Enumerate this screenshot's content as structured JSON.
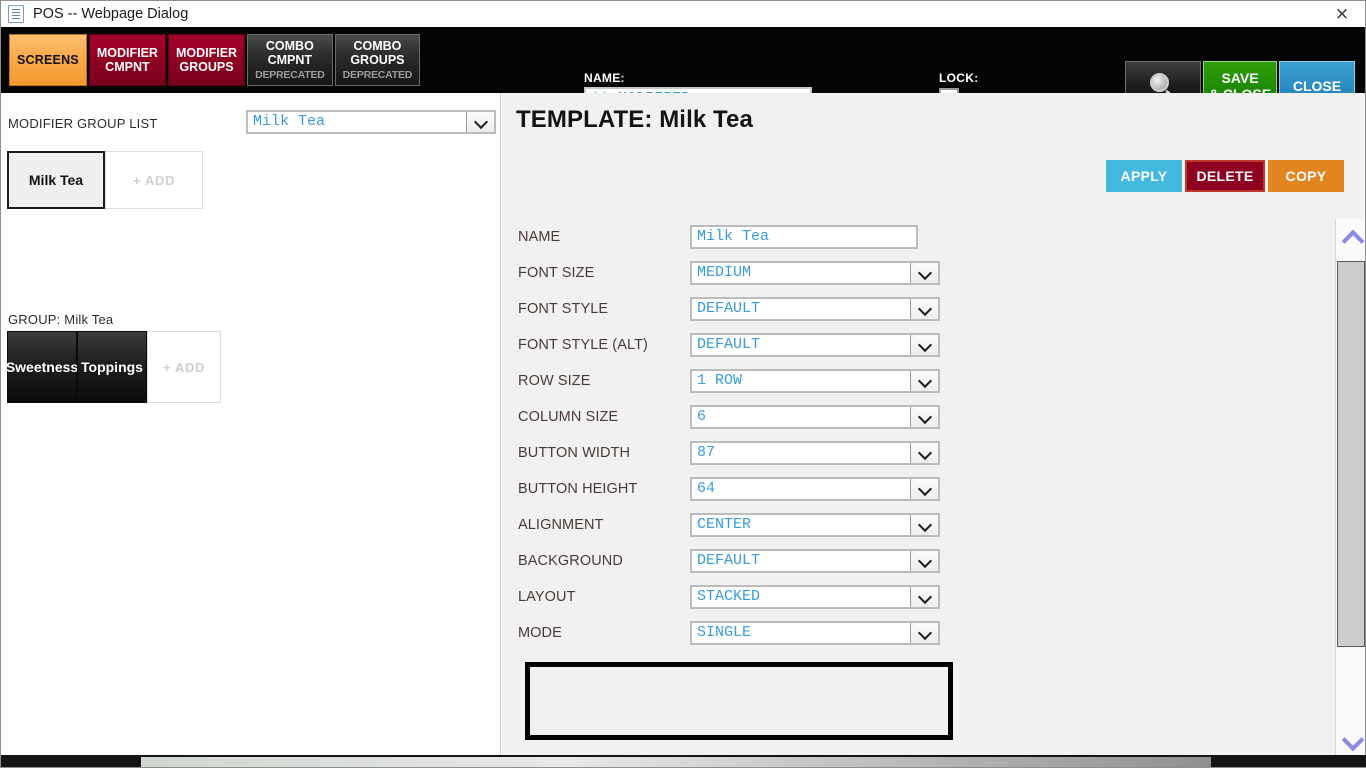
{
  "window": {
    "title": "POS -- Webpage Dialog",
    "doc_icon": "document-icon",
    "close_icon": "×"
  },
  "toolbar": {
    "tabs": [
      {
        "label": "SCREENS",
        "sub": "",
        "style": "screens"
      },
      {
        "label_line1": "MODIFIER",
        "label_line2": "CMPNT",
        "sub": "",
        "style": "crimson"
      },
      {
        "label_line1": "MODIFIER",
        "label_line2": "GROUPS",
        "sub": "",
        "style": "crimson"
      },
      {
        "label_line1": "COMBO",
        "label_line2": "CMPNT",
        "sub": "DEPRECATED",
        "style": "dark"
      },
      {
        "label_line1": "COMBO",
        "label_line2": "GROUPS",
        "sub": "DEPRECATED",
        "style": "dark"
      }
    ],
    "name_caption": "NAME:",
    "name_value": "!! MODIFIER",
    "name_placeholder": "",
    "lock_caption": "LOCK:",
    "lock_checked": false,
    "search_icon": "magnifier-icon",
    "save_label_line1": "SAVE",
    "save_label_line2": "& CLOSE",
    "close_label": "CLOSE",
    "colors": {
      "screens": "#f9a847",
      "crimson": "#8e0021",
      "save": "#1f8a05",
      "close": "#2b8cc2",
      "accent_value": "#3a9bdc"
    }
  },
  "sidebar": {
    "list_label": "MODIFIER GROUP LIST",
    "group_dropdown_value": "Milk Tea",
    "group_buttons": [
      {
        "label": "Milk Tea",
        "state": "selected"
      },
      {
        "label": "+ ADD",
        "state": "add"
      }
    ],
    "group_label": "GROUP: Milk Tea",
    "item_buttons": [
      {
        "label": "Sweetness",
        "state": "dark"
      },
      {
        "label": "Toppings",
        "state": "dark"
      },
      {
        "label": "+ ADD",
        "state": "add"
      }
    ]
  },
  "main": {
    "page_title": "TEMPLATE: Milk Tea",
    "actions": [
      {
        "label": "APPLY",
        "color": "#43b9e0"
      },
      {
        "label": "DELETE",
        "color": "#8e0021"
      },
      {
        "label": "COPY",
        "color": "#e28520"
      }
    ],
    "fields": [
      {
        "label": "NAME",
        "value": "Milk Tea",
        "type": "text"
      },
      {
        "label": "FONT SIZE",
        "value": "MEDIUM",
        "type": "select"
      },
      {
        "label": "FONT STYLE",
        "value": "DEFAULT",
        "type": "select"
      },
      {
        "label": "FONT STYLE (ALT)",
        "value": "DEFAULT",
        "type": "select"
      },
      {
        "label": "ROW SIZE",
        "value": "1 ROW",
        "type": "select"
      },
      {
        "label": "COLUMN SIZE",
        "value": "6",
        "type": "select"
      },
      {
        "label": "BUTTON WIDTH",
        "value": "87",
        "type": "select"
      },
      {
        "label": "BUTTON HEIGHT",
        "value": "64",
        "type": "select"
      },
      {
        "label": "ALIGNMENT",
        "value": "CENTER",
        "type": "select"
      },
      {
        "label": "BACKGROUND",
        "value": "DEFAULT",
        "type": "select"
      },
      {
        "label": "LAYOUT",
        "value": "STACKED",
        "type": "select",
        "highlighted": true
      },
      {
        "label": "MODE",
        "value": "SINGLE",
        "type": "select",
        "highlighted": true
      }
    ]
  },
  "scrollbar": {
    "up_icon": "chevron-up-icon",
    "down_icon": "chevron-down-icon",
    "arrow_color": "#8a8ae8"
  }
}
